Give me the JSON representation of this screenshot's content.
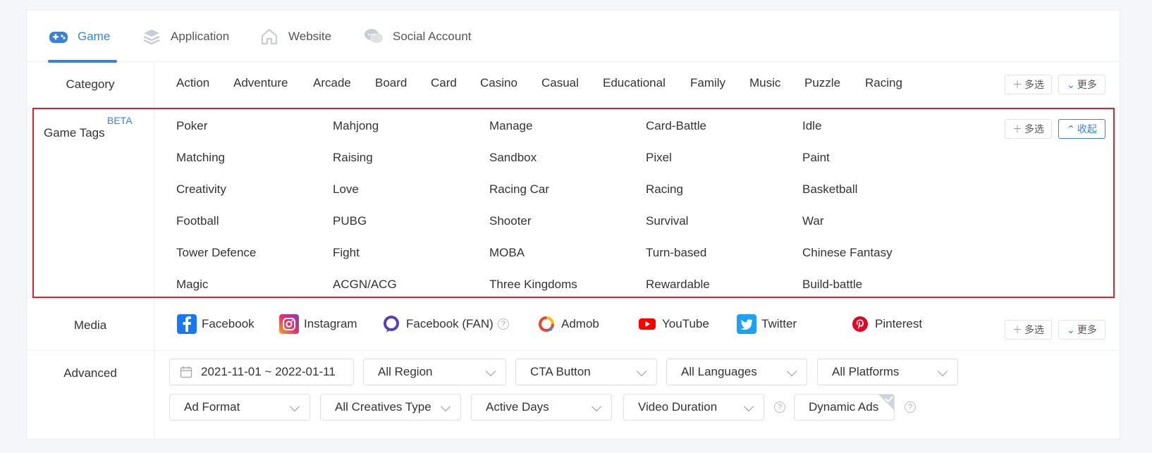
{
  "tabs": [
    {
      "label": "Game",
      "icon": "gamepad-icon",
      "active": true
    },
    {
      "label": "Application",
      "icon": "layers-icon"
    },
    {
      "label": "Website",
      "icon": "home-icon"
    },
    {
      "label": "Social Account",
      "icon": "chat-icon"
    }
  ],
  "category": {
    "label": "Category",
    "items": [
      "Action",
      "Adventure",
      "Arcade",
      "Board",
      "Card",
      "Casino",
      "Casual",
      "Educational",
      "Family",
      "Music",
      "Puzzle",
      "Racing"
    ],
    "multi_label": "多选",
    "more_label": "更多"
  },
  "game_tags": {
    "label": "Game Tags",
    "badge": "BETA",
    "items": [
      "Poker",
      "Mahjong",
      "Manage",
      "Card-Battle",
      "Idle",
      "Matching",
      "Raising",
      "Sandbox",
      "Pixel",
      "Paint",
      "Creativity",
      "Love",
      "Racing Car",
      "Racing",
      "Basketball",
      "Football",
      "PUBG",
      "Shooter",
      "Survival",
      "War",
      "Tower Defence",
      "Fight",
      "MOBA",
      "Turn-based",
      "Chinese Fantasy",
      "Magic",
      "ACGN/ACG",
      "Three Kingdoms",
      "Rewardable",
      "Build-battle"
    ],
    "multi_label": "多选",
    "collapse_label": "收起"
  },
  "media": {
    "label": "Media",
    "items": [
      {
        "label": "Facebook",
        "icon": "facebook-icon",
        "color": "#1877f2"
      },
      {
        "label": "Instagram",
        "icon": "instagram-icon",
        "color": "#e1306c"
      },
      {
        "label": "Facebook (FAN)",
        "icon": "facebook-fan-icon",
        "color": "#5b3fb5"
      },
      {
        "label": "Admob",
        "icon": "admob-icon",
        "color": "#ea4335"
      },
      {
        "label": "YouTube",
        "icon": "youtube-icon",
        "color": "#ff0000"
      },
      {
        "label": "Twitter",
        "icon": "twitter-icon",
        "color": "#1da1f2"
      },
      {
        "label": "Pinterest",
        "icon": "pinterest-icon",
        "color": "#e60023"
      }
    ],
    "multi_label": "多选",
    "more_label": "更多"
  },
  "advanced": {
    "label": "Advanced",
    "date_range": "2021-11-01 ~ 2022-01-11",
    "region": "All Region",
    "cta": "CTA Button",
    "languages": "All Languages",
    "platforms": "All Platforms",
    "ad_format": "Ad Format",
    "creatives_type": "All Creatives Type",
    "active_days": "Active Days",
    "video_duration": "Video Duration",
    "dynamic_ads": "Dynamic Ads"
  },
  "colors": {
    "accent": "#3b82d6",
    "highlight_border": "#d8232a"
  }
}
